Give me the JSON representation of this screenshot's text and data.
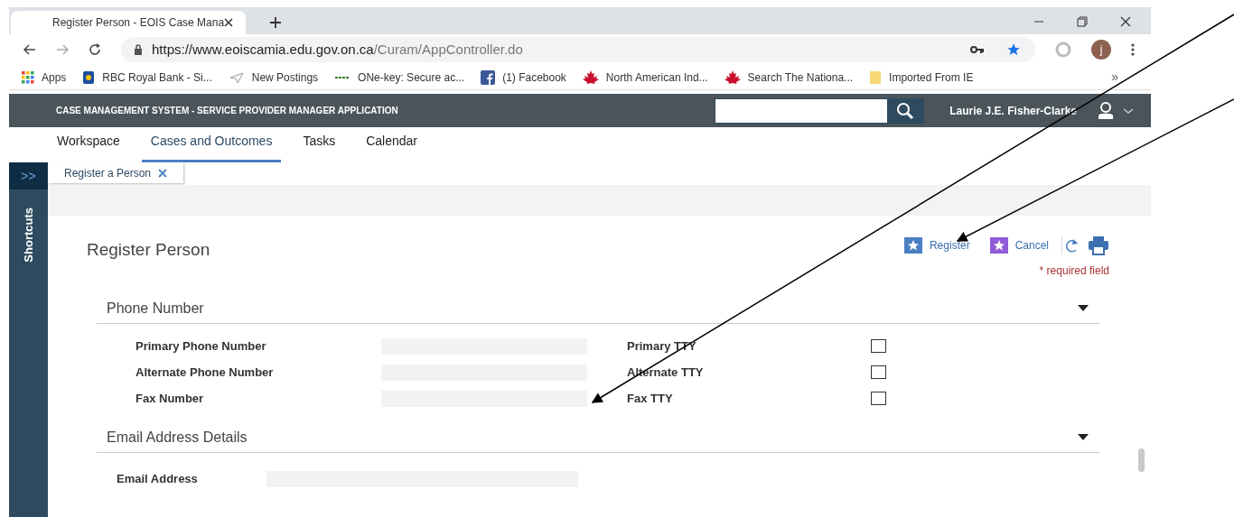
{
  "browser": {
    "tab_title": "Register Person - EOIS Case Mana",
    "url_host": "https://www.eoiscamia.edu.gov.on.ca",
    "url_path": "/Curam/AppController.do",
    "profile_initial": "j",
    "bookmarks": [
      {
        "label": "Apps"
      },
      {
        "label": "RBC Royal Bank - Si..."
      },
      {
        "label": "New Postings"
      },
      {
        "label": "ONe-key: Secure ac..."
      },
      {
        "label": "(1) Facebook"
      },
      {
        "label": "North American Ind..."
      },
      {
        "label": "Search The Nationa..."
      },
      {
        "label": "Imported From IE"
      }
    ],
    "overflow": "»"
  },
  "app": {
    "title": "CASE MANAGEMENT SYSTEM - SERVICE PROVIDER MANAGER APPLICATION",
    "user": "Laurie J.E. Fisher-Clarke",
    "nav": [
      {
        "label": "Workspace",
        "selected": false
      },
      {
        "label": "Cases and Outcomes",
        "selected": true
      },
      {
        "label": "Tasks",
        "selected": false
      },
      {
        "label": "Calendar",
        "selected": false
      }
    ],
    "sidebar": {
      "toggle": ">>",
      "label": "Shortcuts"
    },
    "page_tab": "Register a Person"
  },
  "page": {
    "title": "Register Person",
    "actions": [
      {
        "label": "Register",
        "color": "#4a7fc1"
      },
      {
        "label": "Cancel",
        "color": "#8f5bd6"
      }
    ],
    "required_note": "* required field",
    "sections": [
      {
        "title": "Phone Number",
        "expanded": true,
        "rows": [
          {
            "label": "Primary Phone Number",
            "tty_label": "Primary TTY",
            "tty_checked": false
          },
          {
            "label": "Alternate Phone Number",
            "tty_label": "Alternate TTY",
            "tty_checked": false
          },
          {
            "label": "Fax Number",
            "tty_label": "Fax TTY",
            "tty_checked": false
          }
        ]
      },
      {
        "title": "Email Address Details",
        "expanded": true,
        "rows": [
          {
            "label": "Email Address"
          }
        ]
      }
    ]
  }
}
